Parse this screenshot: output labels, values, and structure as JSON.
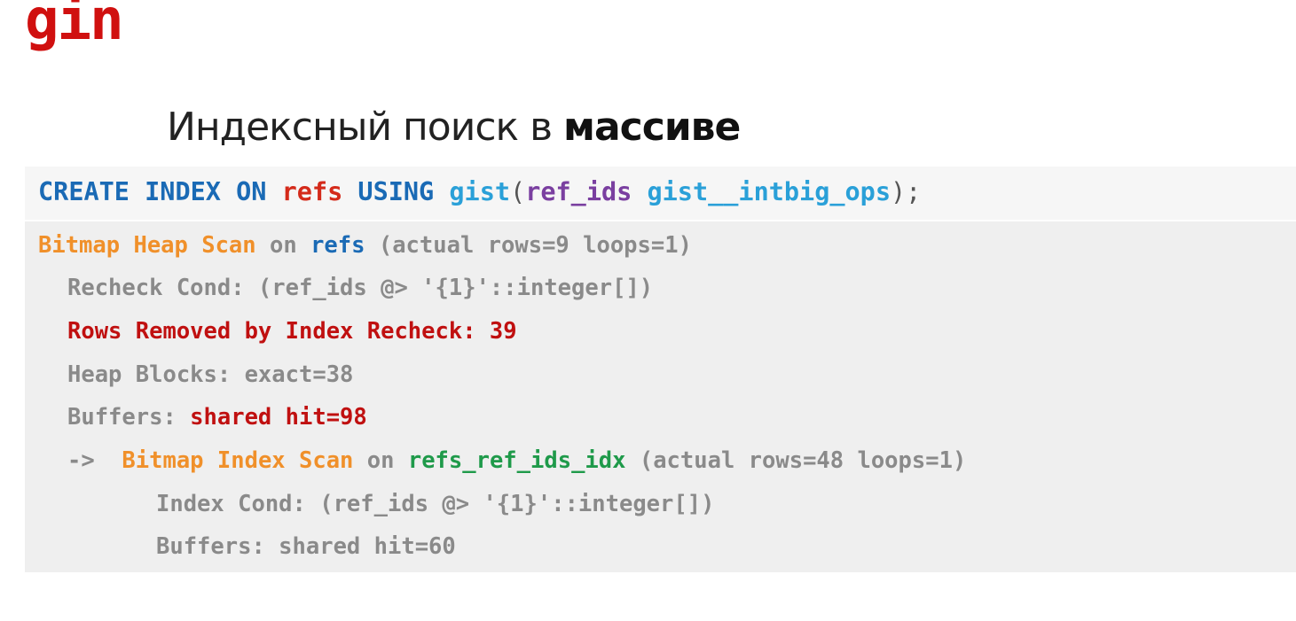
{
  "logo": "gin",
  "subtitle": {
    "normal": "Индексный поиск в ",
    "bold": "массиве"
  },
  "sql": {
    "create": "CREATE",
    "index": "INDEX",
    "on": "ON",
    "table": "refs",
    "using": "USING",
    "method": "gist",
    "open_paren": "(",
    "column": "ref_ids",
    "opclass": "gist__intbig_ops",
    "close": ");"
  },
  "plan": {
    "l1": {
      "node": "Bitmap Heap Scan",
      "on": " on ",
      "table": "refs",
      "rest": " (actual rows=9 loops=1)"
    },
    "l2": "Recheck Cond: (ref_ids @> '{1}'::integer[])",
    "l3": "Rows Removed by Index Recheck: 39",
    "l4": "Heap Blocks: exact=38",
    "l5": {
      "label": "Buffers: ",
      "value": "shared hit=98"
    },
    "l6": {
      "arrow": "-> ",
      "node": "Bitmap Index Scan",
      "on": " on ",
      "index": "refs_ref_ids_idx",
      "rest": " (actual rows=48 loops=1)"
    },
    "l7": "Index Cond: (ref_ids @> '{1}'::integer[])",
    "l8": "Buffers: shared hit=60"
  }
}
